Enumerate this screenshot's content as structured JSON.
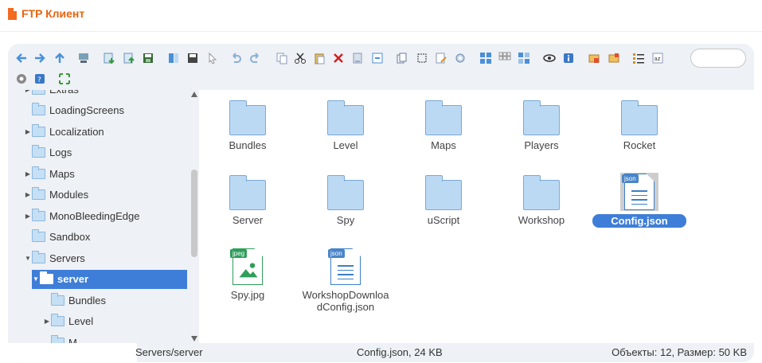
{
  "app": {
    "title": "FTP Клиент",
    "accent_color": "#e8630e",
    "selection_color": "#3f7ed8"
  },
  "toolbar": {
    "buttons": [
      "back-icon",
      "forward-icon",
      "up-icon",
      "connect-icon",
      "download-icon",
      "upload-icon",
      "save-icon",
      "panel-icon",
      "save-all-icon",
      "pointer-icon",
      "undo-icon",
      "redo-icon",
      "copy-icon",
      "cut-icon",
      "paste-icon",
      "delete-icon",
      "rename-icon",
      "properties-icon",
      "duplicate-icon",
      "select-icon",
      "edit-icon",
      "sync-icon",
      "view-large-icon",
      "view-grid-icon",
      "view-tiles-icon",
      "preview-icon",
      "info-icon",
      "new-folder-icon",
      "new-file-icon",
      "list-icon",
      "sort-icon",
      "settings-icon",
      "help-icon",
      "fullscreen-icon"
    ],
    "search_placeholder": ""
  },
  "tree": {
    "items": [
      {
        "label": "Extras",
        "indent": 0,
        "arrow": "▶"
      },
      {
        "label": "LoadingScreens",
        "indent": 0,
        "arrow": ""
      },
      {
        "label": "Localization",
        "indent": 0,
        "arrow": "▶"
      },
      {
        "label": "Logs",
        "indent": 0,
        "arrow": ""
      },
      {
        "label": "Maps",
        "indent": 0,
        "arrow": "▶"
      },
      {
        "label": "Modules",
        "indent": 0,
        "arrow": "▶"
      },
      {
        "label": "MonoBleedingEdge",
        "indent": 0,
        "arrow": "▶"
      },
      {
        "label": "Sandbox",
        "indent": 0,
        "arrow": ""
      },
      {
        "label": "Servers",
        "indent": 0,
        "arrow": "▼"
      },
      {
        "label": "server",
        "indent": 1,
        "arrow": "▼",
        "selected": true
      },
      {
        "label": "Bundles",
        "indent": 2,
        "arrow": ""
      },
      {
        "label": "Level",
        "indent": 2,
        "arrow": "▶"
      },
      {
        "label": "M...",
        "indent": 2,
        "arrow": ""
      }
    ]
  },
  "files": [
    {
      "name": "Bundles",
      "kind": "folder"
    },
    {
      "name": "Level",
      "kind": "folder"
    },
    {
      "name": "Maps",
      "kind": "folder"
    },
    {
      "name": "Players",
      "kind": "folder"
    },
    {
      "name": "Rocket",
      "kind": "folder"
    },
    {
      "name": "Server",
      "kind": "folder"
    },
    {
      "name": "Spy",
      "kind": "folder"
    },
    {
      "name": "uScript",
      "kind": "folder"
    },
    {
      "name": "Workshop",
      "kind": "folder"
    },
    {
      "name": "Config.json",
      "kind": "json",
      "badge": "json",
      "selected": true
    },
    {
      "name": "Spy.jpg",
      "kind": "jpeg",
      "badge": "jpeg"
    },
    {
      "name": "WorkshopDownloadConfig.json",
      "kind": "json",
      "badge": "json"
    }
  ],
  "status": {
    "path": "Servers/server",
    "selection": "Config.json, 24 KB",
    "summary": "Объекты: 12, Размер: 50 KB"
  }
}
